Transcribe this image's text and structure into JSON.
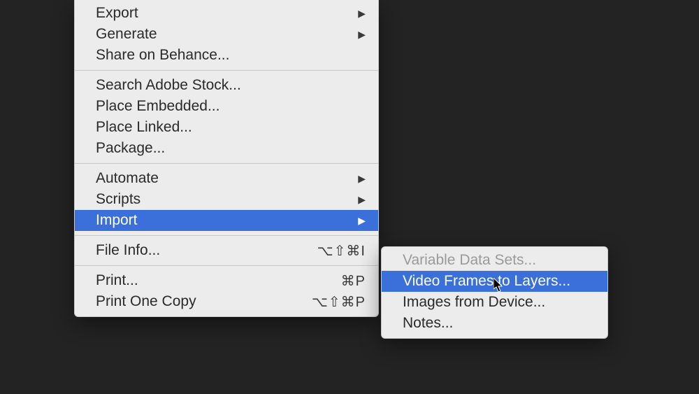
{
  "main_menu": {
    "export": "Export",
    "generate": "Generate",
    "share_behance": "Share on Behance...",
    "search_stock": "Search Adobe Stock...",
    "place_embedded": "Place Embedded...",
    "place_linked": "Place Linked...",
    "package": "Package...",
    "automate": "Automate",
    "scripts": "Scripts",
    "import": "Import",
    "file_info": "File Info...",
    "file_info_shortcut": "⌥⇧⌘I",
    "print": "Print...",
    "print_shortcut": "⌘P",
    "print_one_copy": "Print One Copy",
    "print_one_copy_shortcut": "⌥⇧⌘P"
  },
  "submenu": {
    "variable_data_sets": "Variable Data Sets...",
    "video_frames": "Video Frames to Layers...",
    "images_from_device": "Images from Device...",
    "notes": "Notes..."
  },
  "glyphs": {
    "submenu_arrow": "▶"
  }
}
